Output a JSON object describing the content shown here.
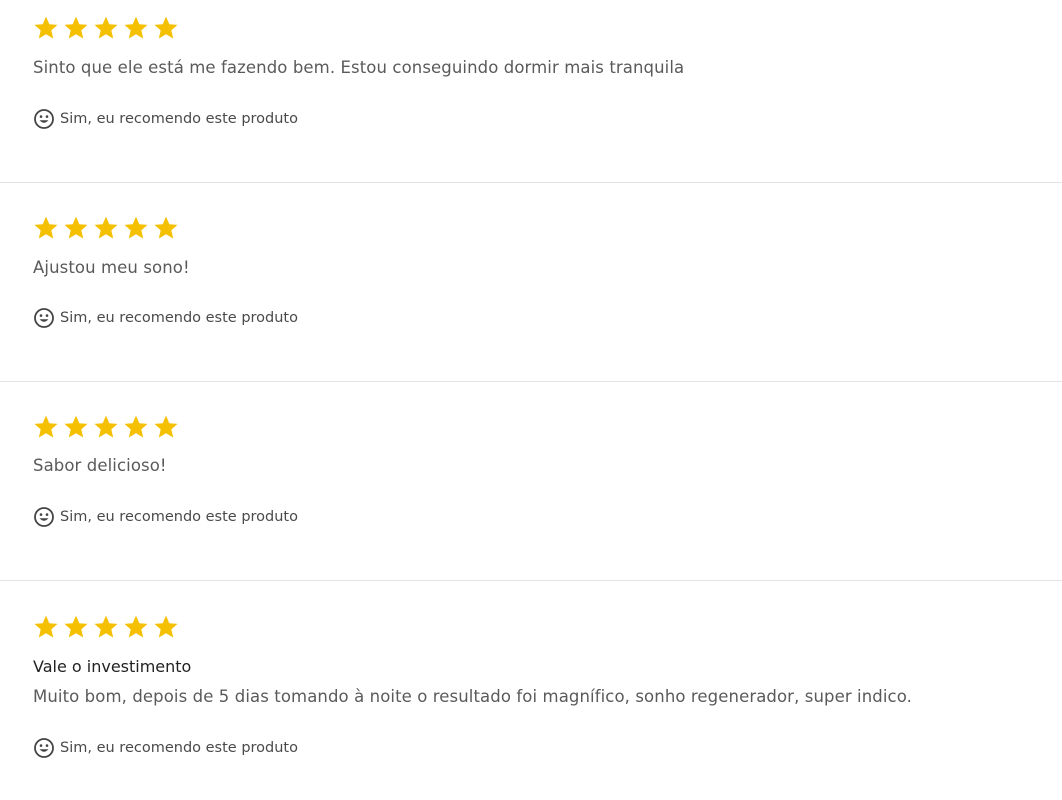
{
  "colors": {
    "star": "#f5c000",
    "text": "#5a5a5a",
    "title": "#222222",
    "divider": "#e3e3e3"
  },
  "reviews": [
    {
      "rating": 5,
      "title": "",
      "text": "Sinto que ele está me fazendo bem. Estou conseguindo dormir mais tranquila",
      "recommend": "Sim, eu recomendo este produto",
      "recommend_icon": "smile-icon"
    },
    {
      "rating": 5,
      "title": "",
      "text": "Ajustou meu sono!",
      "recommend": "Sim, eu recomendo este produto",
      "recommend_icon": "smile-icon"
    },
    {
      "rating": 5,
      "title": "",
      "text": "Sabor delicioso!",
      "recommend": "Sim, eu recomendo este produto",
      "recommend_icon": "smile-icon"
    },
    {
      "rating": 5,
      "title": "Vale o investimento",
      "text": "Muito bom, depois de 5 dias tomando à noite o resultado foi magnífico, sonho regenerador, super indico.",
      "recommend": "Sim, eu recomendo este produto",
      "recommend_icon": "smile-icon"
    }
  ]
}
